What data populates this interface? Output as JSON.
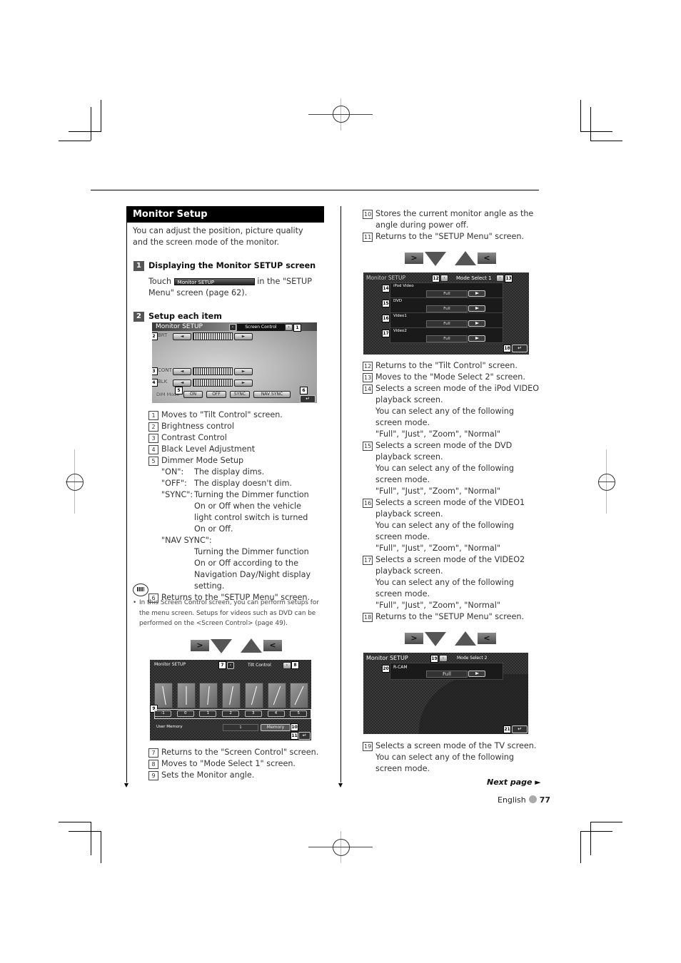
{
  "section": {
    "title": "Monitor Setup",
    "intro": "You can adjust the position, picture quality and the screen mode of the monitor."
  },
  "steps": [
    {
      "number": "1",
      "title": "Displaying the Monitor SETUP screen",
      "text_before": "Touch",
      "inline_button": "Monitor SETUP",
      "text_after": "in the \"SETUP Menu\" screen (page 62)."
    },
    {
      "number": "2",
      "title": "Setup each item"
    }
  ],
  "screen_control": {
    "title": "Monitor SETUP",
    "tab": "Screen Control",
    "rows": [
      {
        "label": "BRT",
        "callout": "2"
      },
      {
        "label": "CONT",
        "callout": "3"
      },
      {
        "label": "BLK",
        "callout": "4"
      }
    ],
    "dim_label": "DIM Mode",
    "dim_buttons": [
      "ON",
      "OFF",
      "SYNC",
      "NAV SYNC"
    ],
    "callouts": {
      "next": "1",
      "dim": "5",
      "return": "6"
    },
    "return_glyph": "↵"
  },
  "screen_control_items": [
    {
      "num": "1",
      "text": "Moves to \"Tilt Control\" screen."
    },
    {
      "num": "2",
      "text": "Brightness control"
    },
    {
      "num": "3",
      "text": "Contrast Control"
    },
    {
      "num": "4",
      "text": "Black Level Adjustment"
    },
    {
      "num": "5",
      "text": "Dimmer Mode Setup"
    }
  ],
  "dimmer_defs": [
    {
      "key": "\"ON\":",
      "value": "The display dims."
    },
    {
      "key": "\"OFF\":",
      "value": "The display doesn't dim."
    },
    {
      "key": "\"SYNC\":",
      "value": "Turning the Dimmer function On or Off when the vehicle light control switch is turned On or Off."
    }
  ],
  "nav_sync": {
    "key": "\"NAV SYNC\":",
    "value": "Turning the Dimmer function On or Off according to the Navigation Day/Night display setting."
  },
  "item6": {
    "num": "6",
    "text": "Returns to the \"SETUP Menu\" screen."
  },
  "note": {
    "icon": "note-icon",
    "bullet": "•",
    "text": "In this Screen Control screen, you can perform setups for the menu screen. Setups for videos such as DVD can be performed on the <Screen Control> (page 49)."
  },
  "nav_glyphs": {
    "next": ">",
    "prev": "<"
  },
  "tilt_control": {
    "title": "Monitor SETUP",
    "tab": "Tilt Control",
    "angles": [
      "-1",
      "0",
      "1",
      "2",
      "3",
      "4",
      "5"
    ],
    "user_memory_label": "User Memory",
    "user_memory_value": "1",
    "memory_button": "Memory",
    "callouts": {
      "prev": "7",
      "next": "8",
      "angles": "9",
      "memory": "10",
      "return": "11"
    },
    "return_glyph": "↵"
  },
  "tilt_items": [
    {
      "num": "7",
      "text": "Returns to the \"Screen Control\" screen."
    },
    {
      "num": "8",
      "text": "Moves to \"Mode Select 1\" screen."
    },
    {
      "num": "9",
      "text": "Sets the Monitor angle."
    }
  ],
  "right_top_items": [
    {
      "num": "10",
      "text": "Stores the current monitor angle as the angle during power off."
    },
    {
      "num": "11",
      "text": "Returns to the \"SETUP Menu\" screen."
    }
  ],
  "mode_select_1": {
    "title": "Monitor SETUP",
    "tab": "Mode Select 1",
    "rows": [
      {
        "label": "iPod Video",
        "value": "Full",
        "callout": "14"
      },
      {
        "label": "DVD",
        "value": "Full",
        "callout": "15"
      },
      {
        "label": "Video1",
        "value": "Full",
        "callout": "16"
      },
      {
        "label": "Video2",
        "value": "Full",
        "callout": "17"
      }
    ],
    "callouts": {
      "prev": "12",
      "next": "13",
      "return": "18"
    },
    "return_glyph": "↵"
  },
  "mode1_items": [
    {
      "num": "12",
      "lines": [
        "Returns to the \"Tilt Control\" screen."
      ]
    },
    {
      "num": "13",
      "lines": [
        "Moves to the \"Mode Select 2\" screen."
      ]
    },
    {
      "num": "14",
      "lines": [
        "Selects a screen mode of the iPod VIDEO playback screen.",
        "You can select any of the following screen mode.",
        "\"Full\", \"Just\", \"Zoom\", \"Normal\""
      ]
    },
    {
      "num": "15",
      "lines": [
        "Selects a screen mode of the DVD playback screen.",
        "You can select any of the following screen mode.",
        "\"Full\", \"Just\", \"Zoom\", \"Normal\""
      ]
    },
    {
      "num": "16",
      "lines": [
        "Selects a screen mode of the VIDEO1 playback screen.",
        "You can select any of the following screen mode.",
        "\"Full\", \"Just\", \"Zoom\", \"Normal\""
      ]
    },
    {
      "num": "17",
      "lines": [
        "Selects a screen mode of the VIDEO2 playback screen.",
        "You can select any of the following screen mode.",
        "\"Full\", \"Just\", \"Zoom\", \"Normal\""
      ]
    },
    {
      "num": "18",
      "lines": [
        "Returns to the \"SETUP Menu\" screen."
      ]
    }
  ],
  "mode_select_2": {
    "title": "Monitor SETUP",
    "tab": "Mode Select 2",
    "rows": [
      {
        "label": "R-CAM",
        "value": "Full",
        "callout": "20"
      }
    ],
    "callouts": {
      "prev": "19",
      "return": "21"
    },
    "return_glyph": "↵"
  },
  "mode2_items": [
    {
      "num": "19",
      "lines": [
        "Selects a screen mode of the TV screen.",
        "You can select any of the following screen mode."
      ]
    }
  ],
  "footer": {
    "next_page": "Next page ►",
    "language": "English",
    "page_number": "77"
  }
}
